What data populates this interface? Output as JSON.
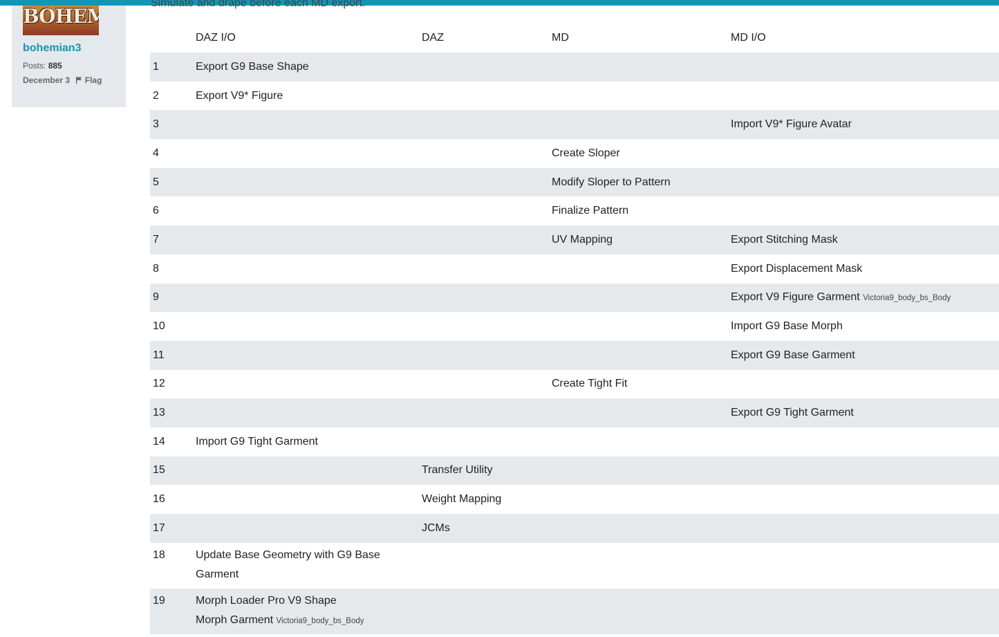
{
  "post_intro": "Simulate and drape before each MD export.",
  "author": {
    "avatar_text": "BOHEME",
    "username": "bohemian3",
    "posts_label": "Posts:",
    "posts_count": "885",
    "date": "December 3",
    "flag_label": "Flag"
  },
  "table": {
    "headers": [
      "",
      "DAZ I/O",
      "DAZ",
      "MD",
      "MD I/O"
    ],
    "rows": [
      {
        "n": "1",
        "daz_io": "Export G9 Base Shape",
        "daz": "",
        "md": "",
        "md_io": "",
        "md_io_small": ""
      },
      {
        "n": "2",
        "daz_io": "Export V9* Figure",
        "daz": "",
        "md": "",
        "md_io": "",
        "md_io_small": ""
      },
      {
        "n": "3",
        "daz_io": "",
        "daz": "",
        "md": "",
        "md_io": "Import V9* Figure Avatar",
        "md_io_small": ""
      },
      {
        "n": "4",
        "daz_io": "",
        "daz": "",
        "md": "Create Sloper",
        "md_io": "",
        "md_io_small": ""
      },
      {
        "n": "5",
        "daz_io": "",
        "daz": "",
        "md": "Modify Sloper to Pattern",
        "md_io": "",
        "md_io_small": ""
      },
      {
        "n": "6",
        "daz_io": "",
        "daz": "",
        "md": "Finalize Pattern",
        "md_io": "",
        "md_io_small": ""
      },
      {
        "n": "7",
        "daz_io": "",
        "daz": "",
        "md": " UV Mapping",
        "md_io": "Export Stitching Mask",
        "md_io_small": ""
      },
      {
        "n": "8",
        "daz_io": "",
        "daz": "",
        "md": "",
        "md_io": "Export Displacement Mask",
        "md_io_small": ""
      },
      {
        "n": "9",
        "daz_io": "",
        "daz": "",
        "md": "",
        "md_io": "Export V9 Figure Garment",
        "md_io_small": "Victoria9_body_bs_Body"
      },
      {
        "n": "10",
        "daz_io": "",
        "daz": "",
        "md": "",
        "md_io": "Import G9 Base Morph",
        "md_io_small": ""
      },
      {
        "n": "11",
        "daz_io": "",
        "daz": "",
        "md": "",
        "md_io": "Export G9 Base Garment",
        "md_io_small": ""
      },
      {
        "n": "12",
        "daz_io": "",
        "daz": "",
        "md": "Create Tight Fit",
        "md_io": "",
        "md_io_small": ""
      },
      {
        "n": "13",
        "daz_io": "",
        "daz": "",
        "md": "",
        "md_io": "Export G9 Tight Garment",
        "md_io_small": ""
      },
      {
        "n": "14",
        "daz_io": "Import G9 Tight Garment",
        "daz": "",
        "md": "",
        "md_io": "",
        "md_io_small": ""
      },
      {
        "n": "15",
        "daz_io": "",
        "daz": "Transfer Utility",
        "md": "",
        "md_io": "",
        "md_io_small": ""
      },
      {
        "n": "16",
        "daz_io": "",
        "daz": "Weight Mapping",
        "md": "",
        "md_io": "",
        "md_io_small": ""
      },
      {
        "n": "17",
        "daz_io": "",
        "daz": "JCMs",
        "md": "",
        "md_io": "",
        "md_io_small": ""
      },
      {
        "n": "18",
        "daz_io": "Update Base Geometry with G9 Base Garment",
        "daz": "",
        "md": "",
        "md_io": "",
        "md_io_small": ""
      }
    ],
    "row19": {
      "n": "19",
      "line1": "Morph Loader Pro V9 Shape",
      "line2": "Morph Garment",
      "line2_small": "Victoria9_body_bs_Body"
    }
  }
}
